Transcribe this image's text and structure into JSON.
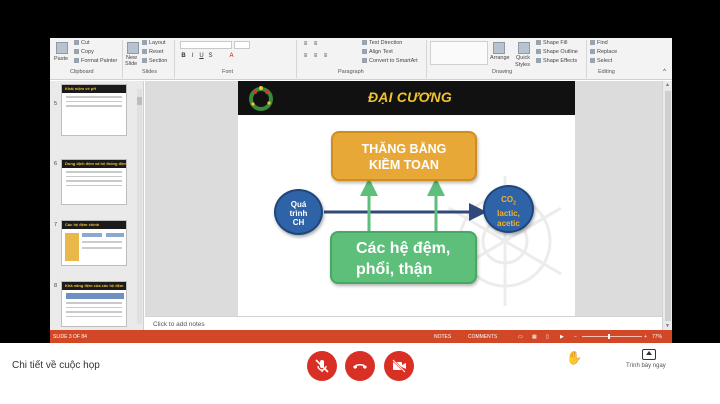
{
  "ribbon": {
    "clipboard": {
      "paste": "Paste",
      "cut": "Cut",
      "copy": "Copy",
      "format_painter": "Format Painter",
      "group": "Clipboard"
    },
    "slides": {
      "new_slide": "New",
      "new_slide2": "Slide",
      "layout": "Layout",
      "reset": "Reset",
      "section": "Section",
      "group": "Slides"
    },
    "font": {
      "group": "Font"
    },
    "paragraph": {
      "text_direction": "Text Direction",
      "align_text": "Align Text",
      "convert_smartart": "Convert to SmartArt",
      "group": "Paragraph"
    },
    "drawing": {
      "arrange": "Arrange",
      "quick_styles": "Quick",
      "quick_styles2": "Styles",
      "shape_fill": "Shape Fill",
      "shape_outline": "Shape Outline",
      "shape_effects": "Shape Effects",
      "group": "Drawing"
    },
    "editing": {
      "find": "Find",
      "replace": "Replace",
      "select": "Select",
      "group": "Editing"
    }
  },
  "thumbnails": [
    {
      "num": "5",
      "head": "Khái niệm về pH"
    },
    {
      "num": "6",
      "head": "Dung dịch đệm và hệ thống đệm"
    },
    {
      "num": "7",
      "head": "Các hệ đệm chính"
    },
    {
      "num": "8",
      "head": "Khả năng đệm của các hệ đệm"
    }
  ],
  "slide": {
    "title": "ĐẠI CƯƠNG",
    "top_box": {
      "line1": "THĂNG BẰNG",
      "line2": "KIỀM TOAN"
    },
    "bottom_box": {
      "line1": "Các hệ đệm,",
      "line2": "phổi, thận"
    },
    "left_circle": {
      "line1": "Quá",
      "line2": "trình",
      "line3": "CH"
    },
    "right_circle": {
      "line1": "CO",
      "sub": "2",
      "line2": "lactic,",
      "line3": "acetic"
    }
  },
  "notes_placeholder": "Click to add notes",
  "status": {
    "slide_counter": "SLIDE 3 OF 84",
    "notes": "NOTES",
    "comments": "COMMENTS",
    "zoom": "77%"
  },
  "meeting": {
    "title": "Chi tiết về cuộc họp",
    "present_label": "Trình bày ngay"
  },
  "colors": {
    "status_bar": "#d24726",
    "title_text": "#f1c232",
    "top_box": "#e8a838",
    "bottom_box": "#5dbf7a",
    "circles": "#2f63a8",
    "end_call": "#d93025"
  }
}
